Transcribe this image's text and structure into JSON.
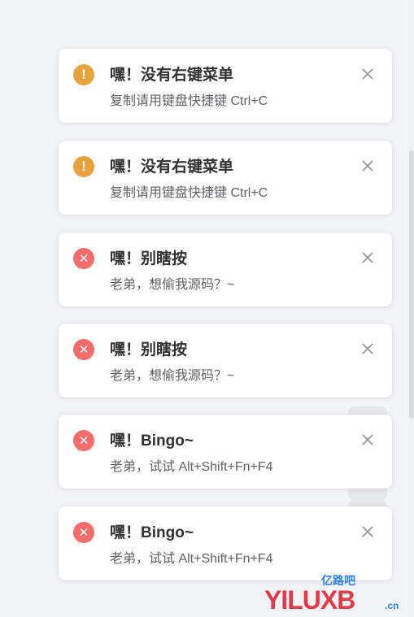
{
  "notifications": [
    {
      "type": "warning",
      "icon": "!",
      "title": "嘿！没有右键菜单",
      "message": "复制请用键盘快捷键 Ctrl+C"
    },
    {
      "type": "warning",
      "icon": "!",
      "title": "嘿！没有右键菜单",
      "message": "复制请用键盘快捷键 Ctrl+C"
    },
    {
      "type": "error",
      "icon": "✕",
      "title": "嘿！别瞎按",
      "message": "老弟，想偷我源码？~"
    },
    {
      "type": "error",
      "icon": "✕",
      "title": "嘿！别瞎按",
      "message": "老弟，想偷我源码？~"
    },
    {
      "type": "error",
      "icon": "✕",
      "title": "嘿！Bingo~",
      "message": "老弟，试试 Alt+Shift+Fn+F4"
    },
    {
      "type": "error",
      "icon": "✕",
      "title": "嘿！Bingo~",
      "message": "老弟，试试 Alt+Shift+Fn+F4"
    }
  ],
  "watermark": {
    "small_text": "亿路吧",
    "big_text": "YILUXB",
    "suffix": ".cn"
  },
  "colors": {
    "warning": "#e6a23c",
    "error": "#f56c6c",
    "background": "#f3f4f7"
  }
}
